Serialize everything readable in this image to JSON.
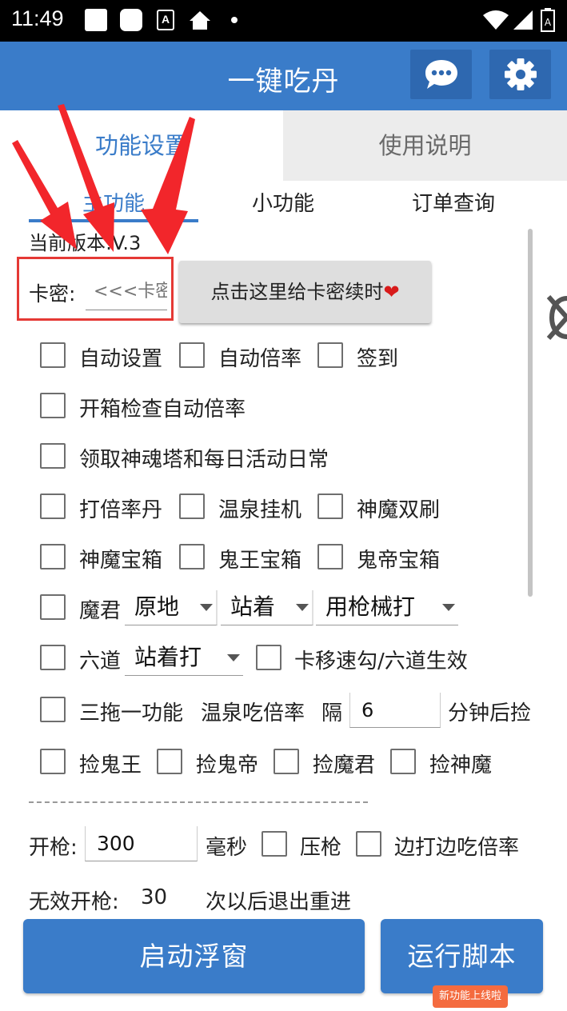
{
  "status_bar": {
    "time": "11:49"
  },
  "app_bar": {
    "title": "一键吃丹"
  },
  "top_tabs": [
    {
      "label": "功能设置"
    },
    {
      "label": "使用说明"
    }
  ],
  "sub_tabs": [
    {
      "label": "主功能"
    },
    {
      "label": "小功能"
    },
    {
      "label": "订单查询"
    }
  ],
  "version_text": "当前版本:V.3",
  "card_key": {
    "label": "卡密:",
    "placeholder": "<<<卡密"
  },
  "renew_button": {
    "label": "点击这里给卡密续时",
    "heart": "❤"
  },
  "options": {
    "auto_settings": "自动设置",
    "auto_rate": "自动倍率",
    "sign_in": "签到",
    "box_check_auto_rate": "开箱检查自动倍率",
    "claim_tower_daily": "领取神魂塔和每日活动日常",
    "hit_rate_pill": "打倍率丹",
    "hot_spring_idle": "温泉挂机",
    "god_demon_double": "神魔双刷",
    "god_demon_chest": "神魔宝箱",
    "ghost_king_chest": "鬼王宝箱",
    "ghost_emperor_chest": "鬼帝宝箱",
    "demon_lord": "魔君",
    "six_paths": "六道",
    "card_move_speed": "卡移速勾/六道生效",
    "three_drag": "三拖一功能",
    "hot_spring_rate": "温泉吃倍率",
    "interval_prefix": "隔",
    "interval_value": "6",
    "interval_suffix": "分钟后捡",
    "pick_ghost_king": "捡鬼王",
    "pick_ghost_emperor": "捡鬼帝",
    "pick_demon_lord": "捡魔君",
    "pick_god_demon": "捡神魔"
  },
  "demon_lord_dropdowns": [
    {
      "value": "原地"
    },
    {
      "value": "站着"
    },
    {
      "value": "用枪械打"
    }
  ],
  "six_paths_dropdown": {
    "value": "站着打"
  },
  "divider_text": "",
  "fire": {
    "label": "开枪:",
    "value": "300",
    "unit": "毫秒",
    "recoil": "压枪",
    "eat_while_fighting": "边打边吃倍率"
  },
  "invalid_fire": {
    "label": "无效开枪:",
    "value": "30",
    "suffix": "次以后退出重进"
  },
  "buttons": {
    "start_float": "启动浮窗",
    "run_script": "运行脚本",
    "new_badge": "新功能上线啦"
  },
  "colors": {
    "primary": "#3a7cc9",
    "highlight": "#e53935",
    "badge": "#f46b3f"
  }
}
